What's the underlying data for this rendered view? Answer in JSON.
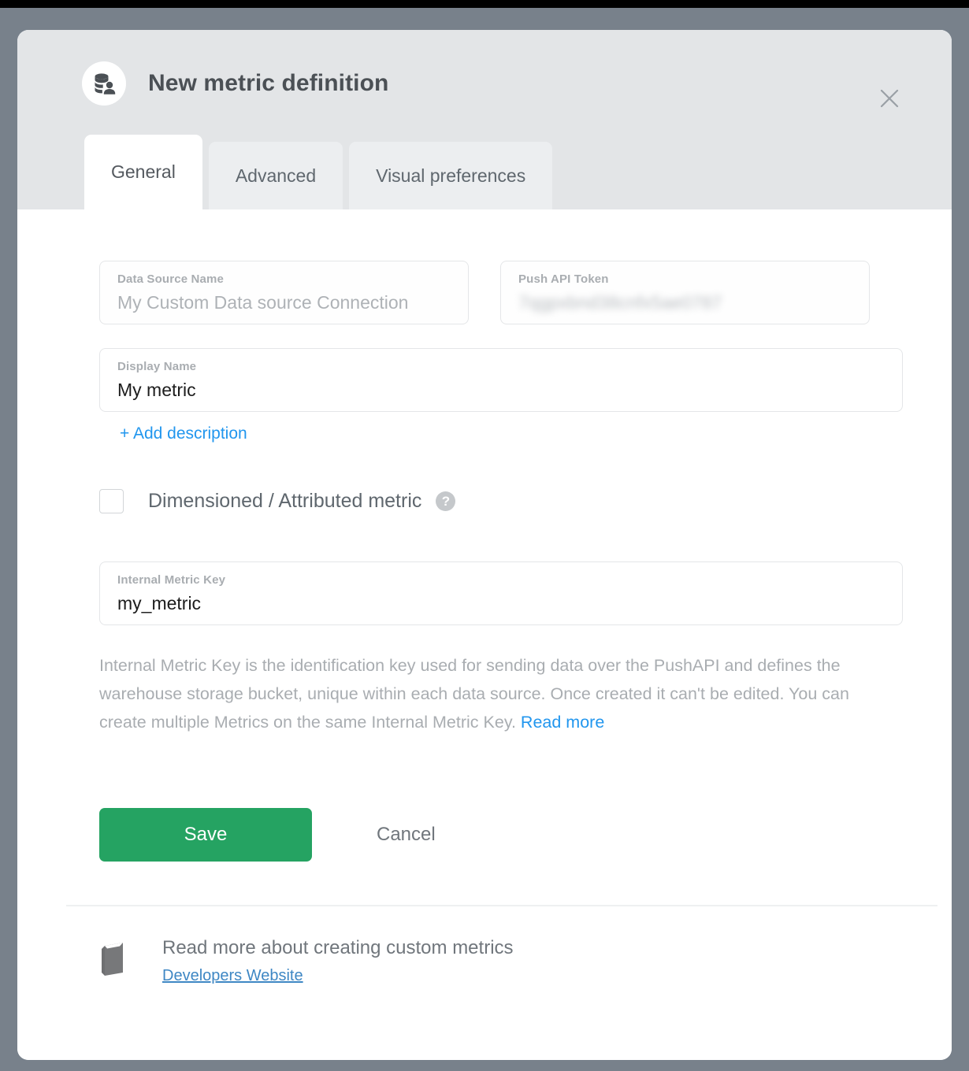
{
  "modal": {
    "title": "New metric definition",
    "title_icon": "database-user-icon",
    "close_icon": "close-icon"
  },
  "tabs": [
    {
      "label": "General",
      "active": true
    },
    {
      "label": "Advanced",
      "active": false
    },
    {
      "label": "Visual preferences",
      "active": false
    }
  ],
  "form": {
    "data_source_name": {
      "label": "Data Source Name",
      "value": "My Custom Data source Connection"
    },
    "push_api_token": {
      "label": "Push API Token",
      "value": "7qgpxbnd38cnfx5ae0787"
    },
    "display_name": {
      "label": "Display Name",
      "value": "My metric"
    },
    "add_description_label": "+ Add description",
    "dimensioned_metric": {
      "label": "Dimensioned / Attributed metric",
      "checked": false,
      "help_icon": "help-circle-icon",
      "help_glyph": "?"
    },
    "internal_metric_key": {
      "label": "Internal Metric Key",
      "value": "my_metric"
    },
    "helper_text": "Internal Metric Key is the identification key used for sending data over the PushAPI and defines the warehouse storage bucket, unique within each data source. Once created it can't be edited. You can create multiple Metrics on the same Internal Metric Key. ",
    "helper_link": "Read more"
  },
  "actions": {
    "save_label": "Save",
    "cancel_label": "Cancel",
    "save_color": "#25a362"
  },
  "footer": {
    "icon": "book-icon",
    "title": "Read more about creating custom metrics",
    "link": "Developers Website"
  }
}
